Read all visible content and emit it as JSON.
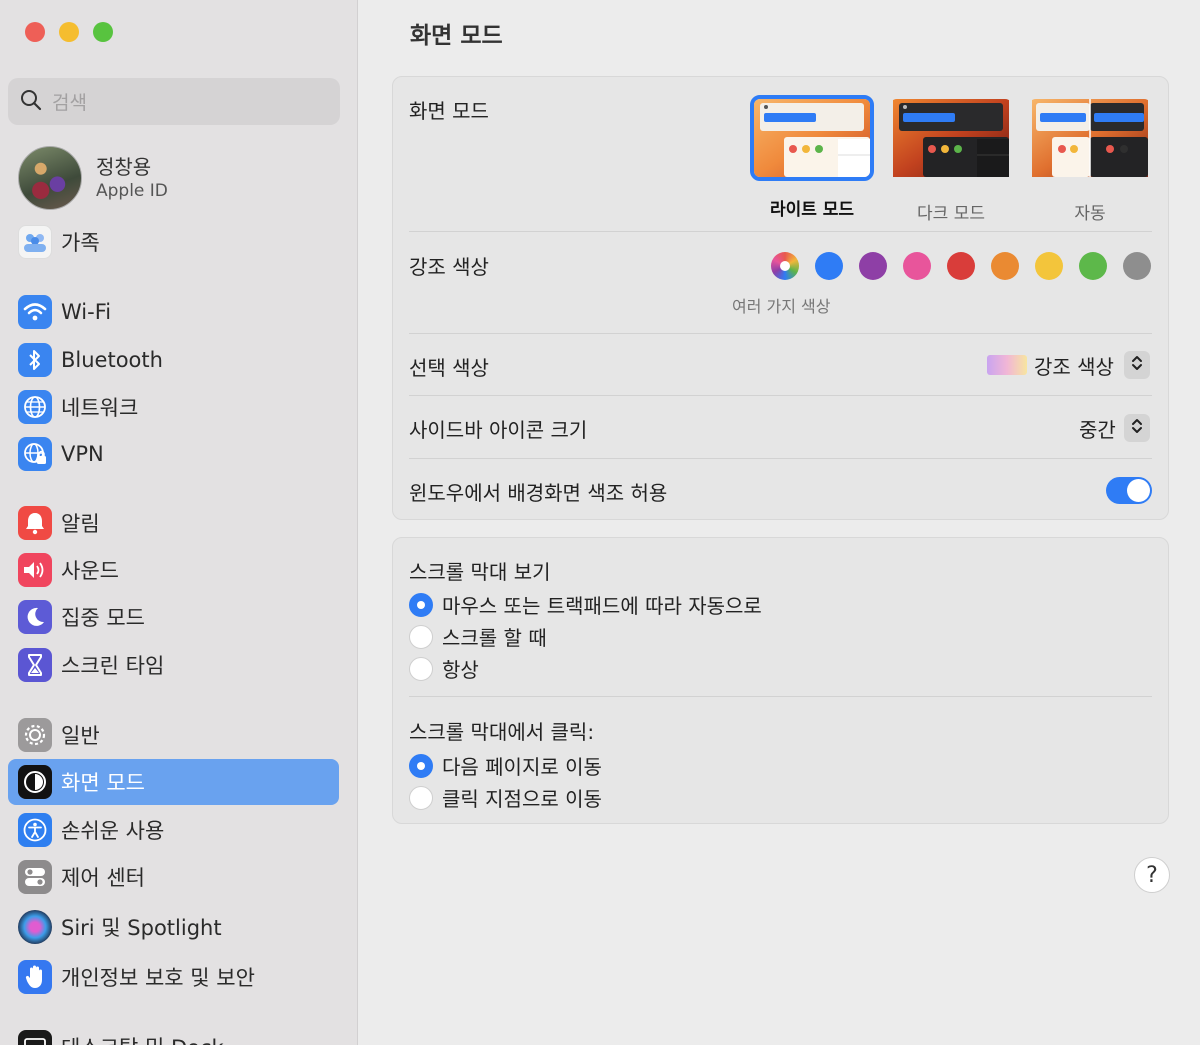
{
  "window": {
    "title": "화면 모드"
  },
  "search": {
    "placeholder": "검색"
  },
  "account": {
    "name": "정창용",
    "subtitle": "Apple ID"
  },
  "sidebar": {
    "items": [
      {
        "label": "가족",
        "icon": "family-icon"
      },
      {
        "label": "Wi-Fi",
        "icon": "wifi-icon"
      },
      {
        "label": "Bluetooth",
        "icon": "bluetooth-icon"
      },
      {
        "label": "네트워크",
        "icon": "globe-icon"
      },
      {
        "label": "VPN",
        "icon": "vpn-globe-icon"
      },
      {
        "label": "알림",
        "icon": "bell-icon"
      },
      {
        "label": "사운드",
        "icon": "speaker-icon"
      },
      {
        "label": "집중 모드",
        "icon": "moon-icon"
      },
      {
        "label": "스크린 타임",
        "icon": "hourglass-icon"
      },
      {
        "label": "일반",
        "icon": "gear-icon"
      },
      {
        "label": "화면 모드",
        "icon": "appearance-icon",
        "selected": true
      },
      {
        "label": "손쉬운 사용",
        "icon": "accessibility-icon"
      },
      {
        "label": "제어 센터",
        "icon": "control-center-icon"
      },
      {
        "label": "Siri 및 Spotlight",
        "icon": "siri-icon"
      },
      {
        "label": "개인정보 보호 및 보안",
        "icon": "hand-icon"
      },
      {
        "label": "데스크탑 및 Dock",
        "icon": "dock-icon"
      }
    ]
  },
  "appearance": {
    "label": "화면 모드",
    "options": [
      {
        "label": "라이트 모드",
        "selected": true
      },
      {
        "label": "다크 모드",
        "selected": false
      },
      {
        "label": "자동",
        "selected": false
      }
    ]
  },
  "accent": {
    "label": "강조 색상",
    "caption": "여러 가지 색상",
    "colors": [
      "multicolor",
      "#2f7cf5",
      "#8e3fa6",
      "#e8559b",
      "#d93d3a",
      "#ea8a32",
      "#f3c53b",
      "#5db84a",
      "#8e8e8e"
    ],
    "selected_index": 0
  },
  "highlight": {
    "label": "선택 색상",
    "value": "강조 색상"
  },
  "sidebar_icon_size": {
    "label": "사이드바 아이콘 크기",
    "value": "중간"
  },
  "wallpaper_tint": {
    "label": "윈도우에서 배경화면 색조 허용",
    "on": true
  },
  "scrollbars": {
    "label": "스크롤 막대 보기",
    "options": [
      {
        "label": "마우스 또는 트랙패드에 따라 자동으로",
        "selected": true
      },
      {
        "label": "스크롤 할 때",
        "selected": false
      },
      {
        "label": "항상",
        "selected": false
      }
    ]
  },
  "scroll_click": {
    "label": "스크롤 막대에서 클릭:",
    "options": [
      {
        "label": "다음 페이지로 이동",
        "selected": true
      },
      {
        "label": "클릭 지점으로 이동",
        "selected": false
      }
    ]
  },
  "help": {
    "label": "?"
  }
}
